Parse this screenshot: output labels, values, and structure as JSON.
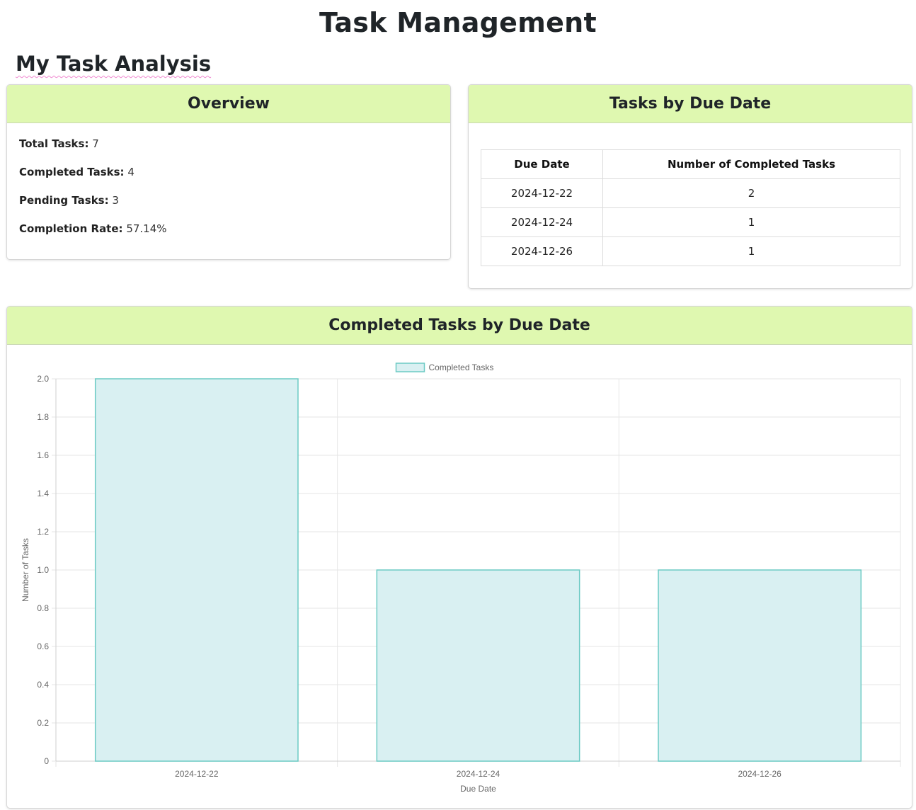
{
  "header": {
    "title": "Task Management"
  },
  "section": {
    "title": "My Task Analysis"
  },
  "overview": {
    "title": "Overview",
    "stats": [
      {
        "label": "Total Tasks:",
        "value": "7"
      },
      {
        "label": "Completed Tasks:",
        "value": "4"
      },
      {
        "label": "Pending Tasks:",
        "value": "3"
      },
      {
        "label": "Completion Rate:",
        "value": "57.14%"
      }
    ]
  },
  "tasks_by_due_date": {
    "title": "Tasks by Due Date",
    "columns": [
      "Due Date",
      "Number of Completed Tasks"
    ],
    "rows": [
      [
        "2024-12-22",
        "2"
      ],
      [
        "2024-12-24",
        "1"
      ],
      [
        "2024-12-26",
        "1"
      ]
    ]
  },
  "chart_card": {
    "title": "Completed Tasks by Due Date"
  },
  "chart_data": {
    "type": "bar",
    "categories": [
      "2024-12-22",
      "2024-12-24",
      "2024-12-26"
    ],
    "series": [
      {
        "name": "Completed Tasks",
        "values": [
          2,
          1,
          1
        ]
      }
    ],
    "xlabel": "Due Date",
    "ylabel": "Number of Tasks",
    "ylim": [
      0,
      2
    ],
    "yticks": [
      "0",
      "0.2",
      "0.4",
      "0.6",
      "0.8",
      "1.0",
      "1.2",
      "1.4",
      "1.6",
      "1.8",
      "2.0"
    ],
    "grid": true,
    "legend": "top-center",
    "colors": {
      "bar_fill": "#d9f0f2",
      "bar_stroke": "#6ccac4",
      "grid": "#e6e6e6",
      "header_bg": "#dff8b0"
    }
  }
}
